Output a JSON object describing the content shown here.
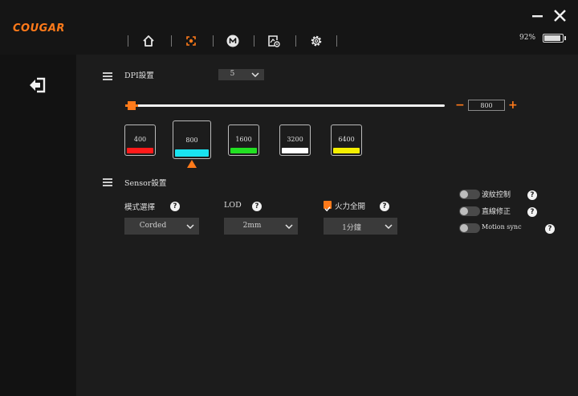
{
  "app": {
    "brand": "COUGAR"
  },
  "battery": {
    "percent_label": "92%",
    "level": 0.92
  },
  "dpi": {
    "label": "DPI設置",
    "stage_count": "5",
    "value": "800",
    "minus": "−",
    "plus": "+",
    "stages": [
      {
        "value": "400",
        "color": "#ff1a1a"
      },
      {
        "value": "800",
        "color": "#19e3f0"
      },
      {
        "value": "1600",
        "color": "#22e022"
      },
      {
        "value": "3200",
        "color": "#ffffff"
      },
      {
        "value": "6400",
        "color": "#f5ef00"
      }
    ]
  },
  "sensor": {
    "label": "Sensor設置",
    "mode": {
      "label": "模式選擇",
      "value": "Corded"
    },
    "lod": {
      "label": "LOD",
      "value": "2mm"
    },
    "fire": {
      "label": "火力全開",
      "value": "1分鐘"
    },
    "toggles": [
      {
        "label": "波紋控制"
      },
      {
        "label": "直線修正"
      },
      {
        "label": "Motion sync"
      }
    ]
  },
  "colors": {
    "accent": "#ff7a1a"
  },
  "icons": [
    "home-icon",
    "dpi-target-icon",
    "macro-icon",
    "profile-settings-icon",
    "settings-gear-icon",
    "minimize-icon",
    "close-icon",
    "logout-arrow-icon"
  ]
}
